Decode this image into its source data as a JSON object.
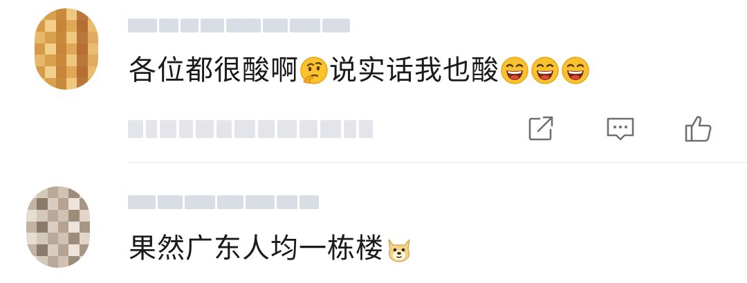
{
  "comments": [
    {
      "text_parts": [
        "各位都很酸啊",
        "说实话我也酸"
      ],
      "emojis": [
        "thinking-face-emoji",
        "laughing-emoji",
        "laughing-emoji",
        "laughing-emoji"
      ]
    },
    {
      "text_parts": [
        "果然广东人均一栋楼"
      ],
      "emojis": [
        "doge-emoji"
      ]
    }
  ],
  "actions": [
    "share-icon",
    "comment-icon",
    "like-icon"
  ],
  "colors": {
    "text": "#1a1a1a",
    "icon": "#6b6f76",
    "blur": "#d9dde6",
    "divider": "#e6e6e6"
  }
}
